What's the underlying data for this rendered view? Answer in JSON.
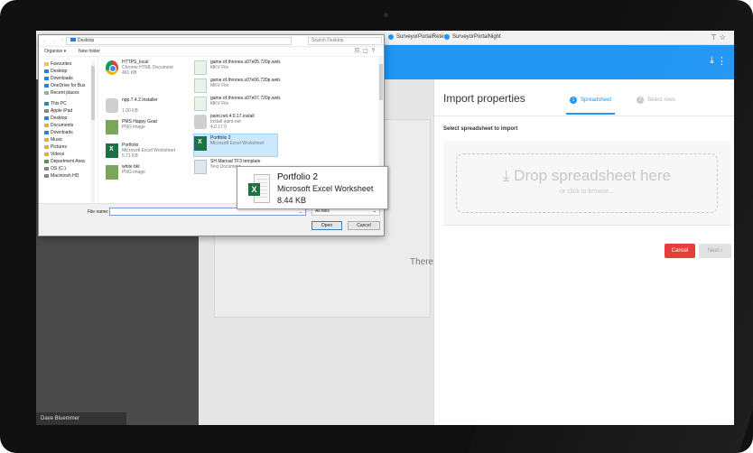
{
  "browser": {
    "tabs": [
      {
        "label": "SurveyorPortalRetest"
      },
      {
        "label": "SurveyorPortalNight"
      }
    ],
    "toolbar_icons": [
      "pin-icon",
      "star-icon"
    ]
  },
  "app": {
    "sidebar_bottom_label": "Dave Bluemmer",
    "background_text": "There"
  },
  "import_panel": {
    "title": "Import properties",
    "steps": [
      {
        "num": "1",
        "label": "Spreadsheet",
        "active": true
      },
      {
        "num": "2",
        "label": "Select rows",
        "active": false
      }
    ],
    "subheading": "Select spreadsheet to import",
    "dropzone_main": "Drop spreadsheet here",
    "dropzone_sub": "or click to browse...",
    "cancel_label": "Cancel",
    "next_label": "Next"
  },
  "file_dialog": {
    "address": "Desktop",
    "search_placeholder": "Search Desktop",
    "toolbar": {
      "organize": "Organise ▾",
      "new_folder": "New folder"
    },
    "nav_items": [
      {
        "label": "Favourites",
        "color": "#f2c14e"
      },
      {
        "label": "Desktop",
        "color": "#2a7de1"
      },
      {
        "label": "Downloads",
        "color": "#2a7de1"
      },
      {
        "label": "OneDrive for Bus",
        "color": "#2a7de1"
      },
      {
        "label": "Recent places",
        "color": "#9aa8b8"
      },
      {
        "label": "",
        "color": ""
      },
      {
        "label": "This PC",
        "color": "#2a7de1"
      },
      {
        "label": "Apple iPad",
        "color": "#888888"
      },
      {
        "label": "Desktop",
        "color": "#2a7de1"
      },
      {
        "label": "Documents",
        "color": "#d9b44a"
      },
      {
        "label": "Downloads",
        "color": "#2a7de1"
      },
      {
        "label": "Music",
        "color": "#d9b44a"
      },
      {
        "label": "Pictures",
        "color": "#d9b44a"
      },
      {
        "label": "Videos",
        "color": "#d9b44a"
      },
      {
        "label": "Department Area",
        "color": "#5a8f5a"
      },
      {
        "label": "OS (C:)",
        "color": "#888888"
      },
      {
        "label": "Macintosh HD",
        "color": "#888888"
      }
    ],
    "files": [
      {
        "name": "HTTPS_local",
        "meta": "Chrome HTML Document",
        "meta2": "461 KB",
        "icon": "chrome-icon"
      },
      {
        "name": "game.of.thrones.s07e05.720p.web.",
        "meta": "MKV File",
        "meta2": "",
        "icon": "video-file-icon"
      },
      {
        "name": "game.of.thrones.s07e06.720p.web.",
        "meta": "MKV File",
        "meta2": "",
        "icon": "video-file-icon"
      },
      {
        "name": "game.of.thrones.s07e07.720p.web.",
        "meta": "MKV File",
        "meta2": "",
        "icon": "video-file-icon"
      },
      {
        "name": "npp.7.4.2.Installer",
        "meta": "",
        "meta2": "1.00 KB",
        "icon": "installer-icon"
      },
      {
        "name": "paint.net.4.0.17.install",
        "meta": "Install paint.net",
        "meta2": "4.0.17.0",
        "icon": "installer-icon"
      },
      {
        "name": "PMS Happy Goat",
        "meta": "PNG image",
        "meta2": "",
        "icon": "image-file-icon"
      },
      {
        "name": "Portfolio 2",
        "meta": "Microsoft Excel Worksheet",
        "meta2": "",
        "icon": "excel-file-icon"
      },
      {
        "name": "Portfolio",
        "meta": "Microsoft Excel Worksheet",
        "meta2": "5.71 KB",
        "icon": "excel-file-icon"
      },
      {
        "name": "SH Manual TF3 template",
        "meta": "Text Document",
        "meta2": "",
        "icon": "text-file-icon"
      },
      {
        "name": "white bkl",
        "meta": "PNG image",
        "meta2": "",
        "icon": "image-file-icon"
      }
    ],
    "tooltip": {
      "name": "Portfolio 2",
      "type": "Microsoft Excel Worksheet",
      "size": "8.44 KB"
    },
    "file_name_label": "File name:",
    "file_name_value": "",
    "filter_value": "All files",
    "open_label": "Open",
    "cancel_label": "Cancel"
  },
  "colors": {
    "accent": "#2196f3",
    "danger": "#e53935",
    "excel": "#1e7145"
  }
}
